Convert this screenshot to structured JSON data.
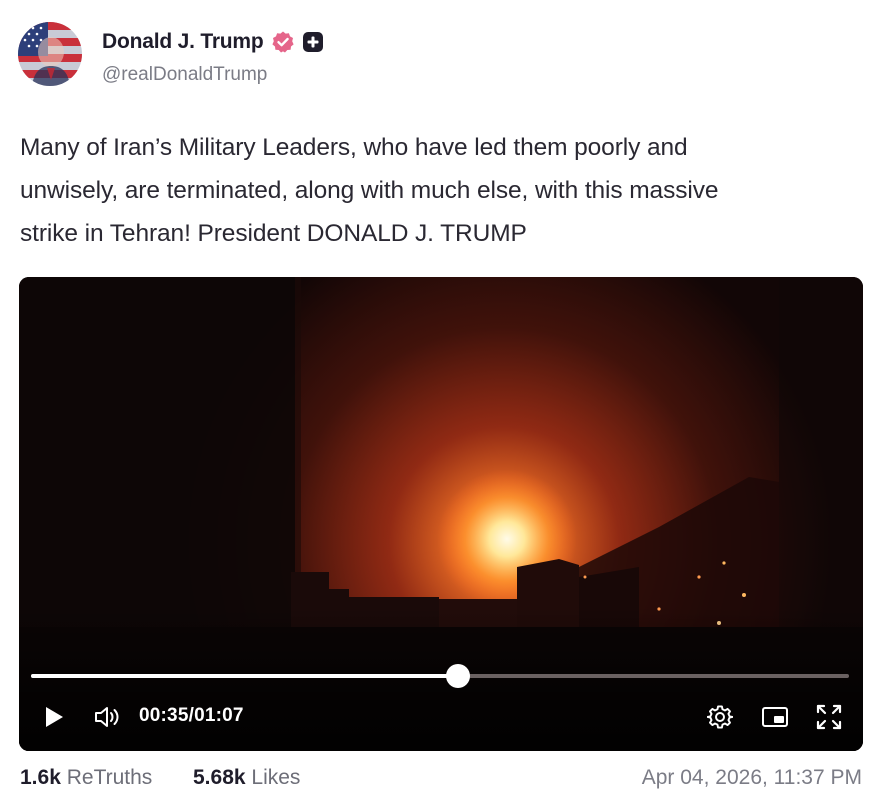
{
  "author": {
    "display_name": "Donald J. Trump",
    "handle": "@realDonaldTrump",
    "avatar_icon": "flag-portrait-avatar",
    "verified_icon": "verified-badge-icon",
    "plus_icon": "plus-badge-icon"
  },
  "post": {
    "text": "Many of Iran’s Military Leaders, who have led them poorly and\nunwisely, are terminated, along with much else, with this massive\nstrike in Tehran! President DONALD J. TRUMP"
  },
  "video": {
    "current_time": "00:35",
    "separator": "/",
    "duration": "01:07",
    "progress_fraction": 0.522,
    "icons": [
      "play-icon",
      "volume-icon",
      "settings-icon",
      "picture-in-picture-icon",
      "fullscreen-icon"
    ]
  },
  "stats": {
    "retruths_count": "1.6k",
    "retruths_label": "ReTruths",
    "likes_count": "5.68k",
    "likes_label": "Likes"
  },
  "timestamp": "Apr 04, 2026, 11:37 PM",
  "colors": {
    "verified": "#e5658a",
    "name": "#1f1d2b",
    "muted": "#7b7c86",
    "video_bg": "#0b0606"
  }
}
